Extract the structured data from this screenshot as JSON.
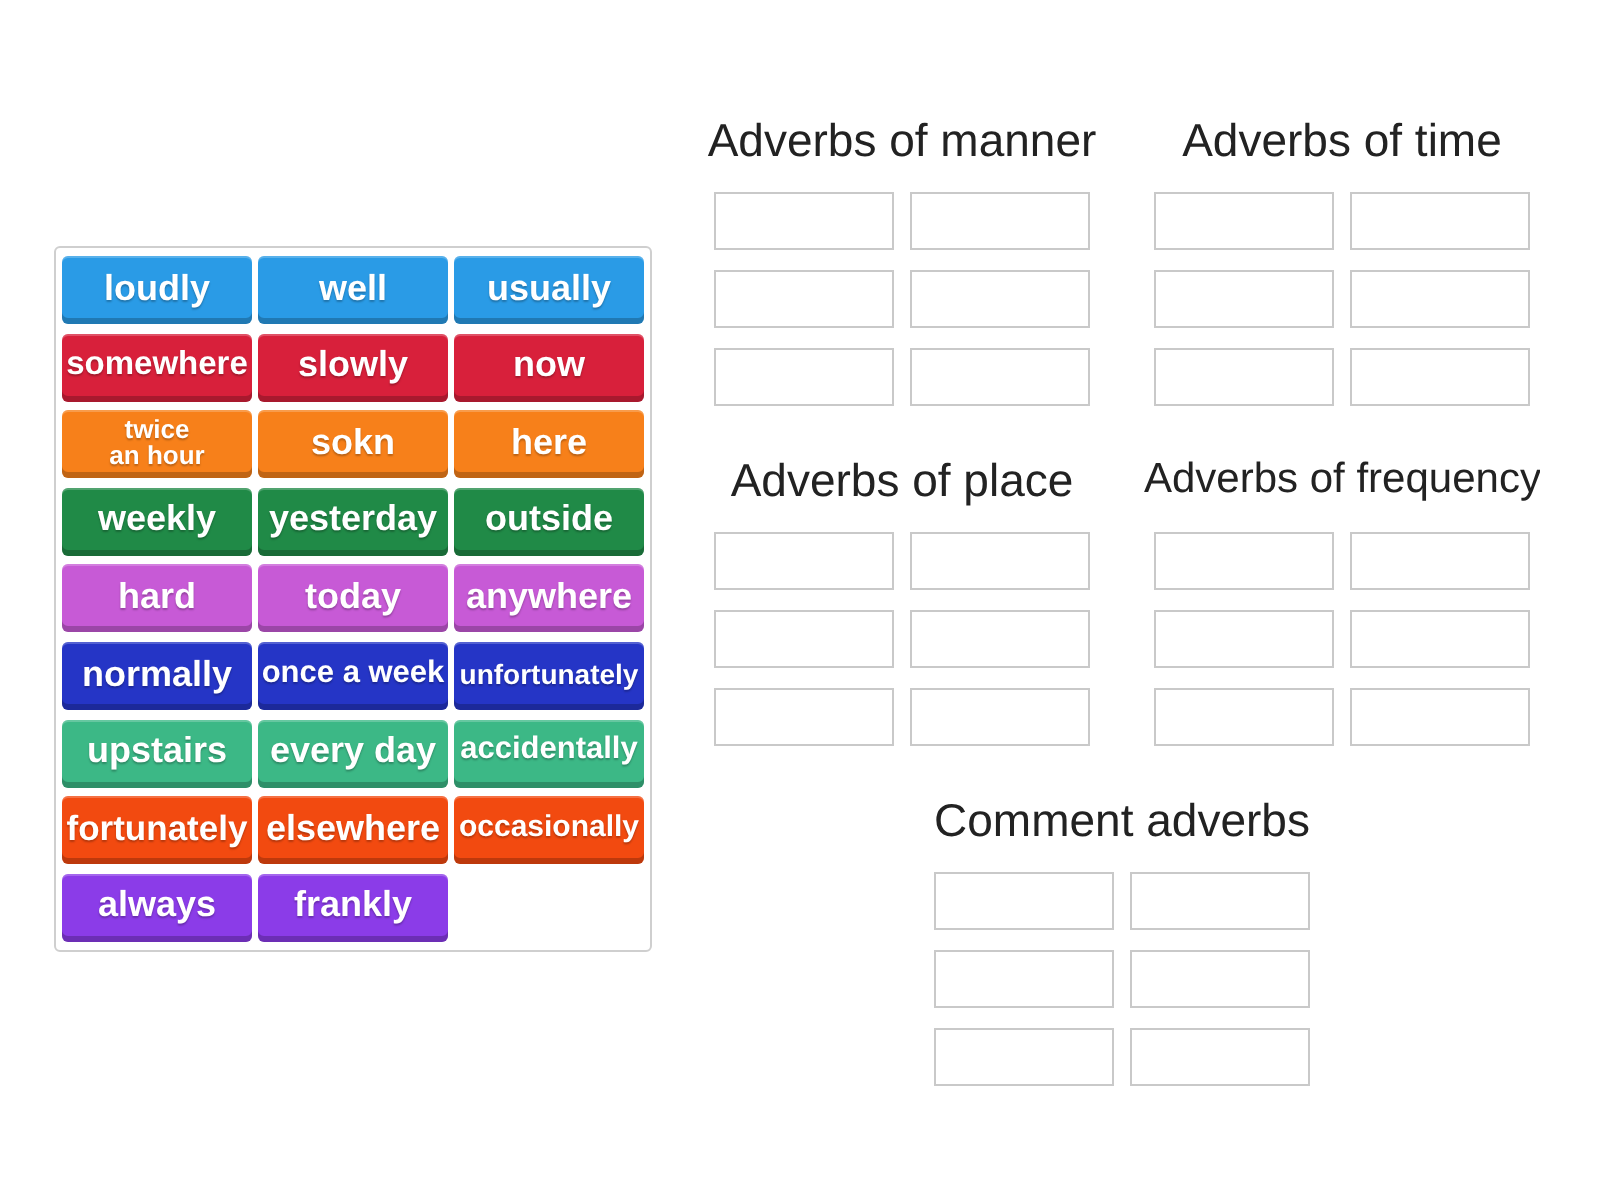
{
  "tiles": [
    {
      "text": "loudly",
      "color": "#2a9be6"
    },
    {
      "text": "well",
      "color": "#2a9be6"
    },
    {
      "text": "usually",
      "color": "#2a9be6"
    },
    {
      "text": "somewhere",
      "color": "#d8203b"
    },
    {
      "text": "slowly",
      "color": "#d8203b"
    },
    {
      "text": "now",
      "color": "#d8203b"
    },
    {
      "text": "twice an hour",
      "color": "#f7801a"
    },
    {
      "text": "sokn",
      "color": "#f7801a"
    },
    {
      "text": "here",
      "color": "#f7801a"
    },
    {
      "text": "weekly",
      "color": "#208a47"
    },
    {
      "text": "yesterday",
      "color": "#208a47"
    },
    {
      "text": "outside",
      "color": "#208a47"
    },
    {
      "text": "hard",
      "color": "#c75ad6"
    },
    {
      "text": "today",
      "color": "#c75ad6"
    },
    {
      "text": "anywhere",
      "color": "#c75ad6"
    },
    {
      "text": "normally",
      "color": "#2535c6"
    },
    {
      "text": "once a week",
      "color": "#2535c6"
    },
    {
      "text": "unfortunately",
      "color": "#2535c6"
    },
    {
      "text": "upstairs",
      "color": "#3cb886"
    },
    {
      "text": "every day",
      "color": "#3cb886"
    },
    {
      "text": "accidentally",
      "color": "#3cb886"
    },
    {
      "text": "fortunately",
      "color": "#f24a10"
    },
    {
      "text": "elsewhere",
      "color": "#f24a10"
    },
    {
      "text": "occasionally",
      "color": "#f24a10"
    },
    {
      "text": "always",
      "color": "#8b3ce8"
    },
    {
      "text": "frankly",
      "color": "#8b3ce8"
    }
  ],
  "groups": [
    {
      "title": "Adverbs of manner",
      "slots": [
        {
          "kind": "empty"
        },
        {
          "kind": "empty"
        },
        {
          "kind": "empty"
        },
        {
          "kind": "empty"
        },
        {
          "kind": "empty"
        },
        {
          "kind": "empty"
        }
      ]
    },
    {
      "title": "Adverbs of time",
      "slots": [
        {
          "kind": "empty"
        },
        {
          "kind": "empty"
        },
        {
          "kind": "empty"
        },
        {
          "kind": "empty"
        },
        {
          "kind": "empty"
        },
        {
          "kind": "empty"
        }
      ]
    },
    {
      "title": "Adverbs of place",
      "slots": [
        {
          "kind": "empty"
        },
        {
          "kind": "empty"
        },
        {
          "kind": "empty"
        },
        {
          "kind": "empty"
        },
        {
          "kind": "empty"
        },
        {
          "kind": "empty"
        }
      ]
    },
    {
      "title": "Adverbs of frequency",
      "slots": [
        {
          "kind": "empty"
        },
        {
          "kind": "empty"
        },
        {
          "kind": "empty"
        },
        {
          "kind": "empty"
        },
        {
          "kind": "empty"
        },
        {
          "kind": "empty"
        }
      ]
    },
    {
      "title": "Comment adverbs",
      "slots": [
        {
          "kind": "empty"
        },
        {
          "kind": "empty"
        },
        {
          "kind": "empty"
        },
        {
          "kind": "empty"
        },
        {
          "kind": "empty"
        },
        {
          "kind": "empty"
        }
      ]
    }
  ]
}
